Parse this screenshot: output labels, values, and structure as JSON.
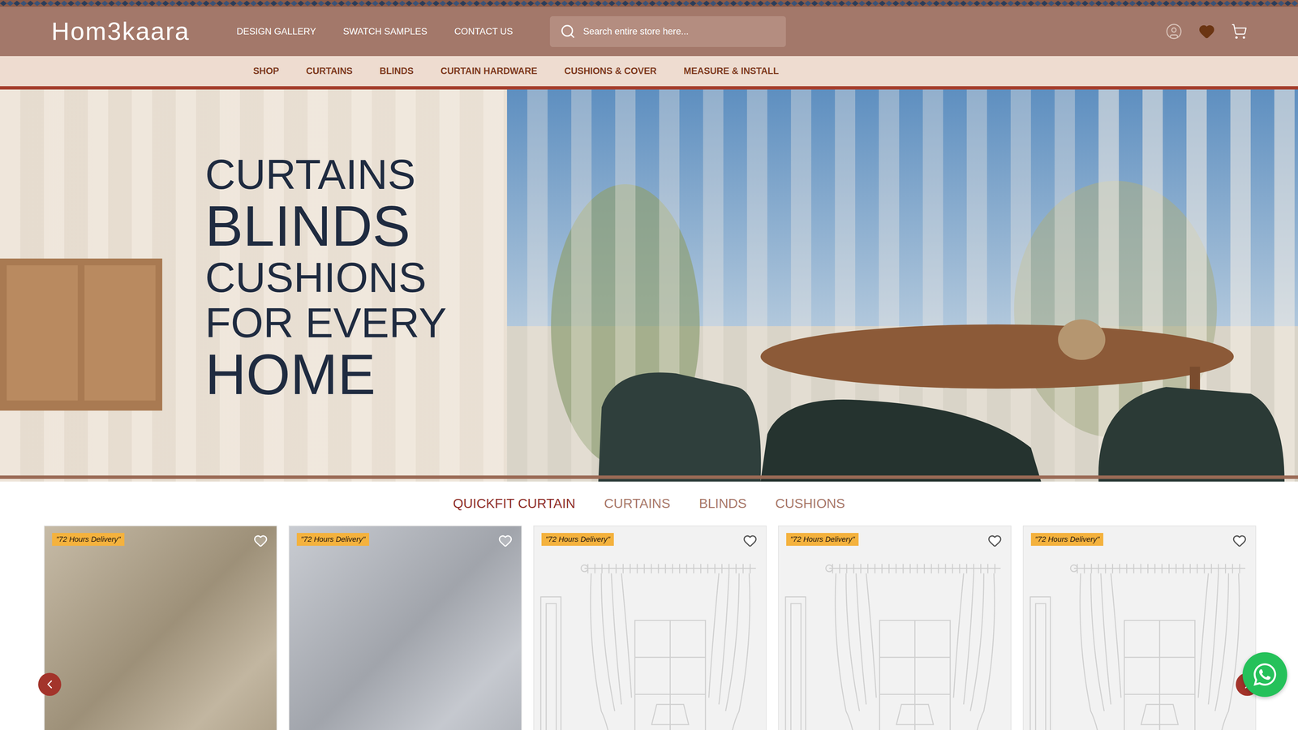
{
  "logo": "Hom3kaara",
  "top_nav": [
    "DESIGN GALLERY",
    "SWATCH SAMPLES",
    "CONTACT US"
  ],
  "search": {
    "placeholder": "Search entire store here..."
  },
  "category_nav": [
    "SHOP",
    "CURTAINS",
    "BLINDS",
    "CURTAIN HARDWARE",
    "CUSHIONS & COVER",
    "MEASURE & INSTALL"
  ],
  "hero": {
    "lines": [
      {
        "text": "CURTAINS",
        "kind": "medium"
      },
      {
        "text": "BLINDS",
        "kind": "large"
      },
      {
        "text": "CUSHIONS",
        "kind": "medium"
      },
      {
        "text": "FOR EVERY",
        "kind": "medium"
      },
      {
        "text": "HOME",
        "kind": "large"
      }
    ]
  },
  "tabs": [
    {
      "label": "QUICKFIT CURTAIN",
      "selected": true
    },
    {
      "label": "CURTAINS",
      "selected": false
    },
    {
      "label": "BLINDS",
      "selected": false
    },
    {
      "label": "CUSHIONS",
      "selected": false
    }
  ],
  "products": [
    {
      "badge": "\"72 Hours Delivery\"",
      "kind": "swatch",
      "color": "#b3a489",
      "favorite": false
    },
    {
      "badge": "\"72 Hours Delivery\"",
      "kind": "swatch",
      "color": "#b7bbc3",
      "favorite": false
    },
    {
      "badge": "\"72 Hours Delivery\"",
      "kind": "sketch",
      "color": "#f2f2f2",
      "favorite": false
    },
    {
      "badge": "\"72 Hours Delivery\"",
      "kind": "sketch",
      "color": "#f2f2f2",
      "favorite": false
    },
    {
      "badge": "\"72 Hours Delivery\"",
      "kind": "sketch",
      "color": "#f2f2f2",
      "favorite": false
    }
  ]
}
